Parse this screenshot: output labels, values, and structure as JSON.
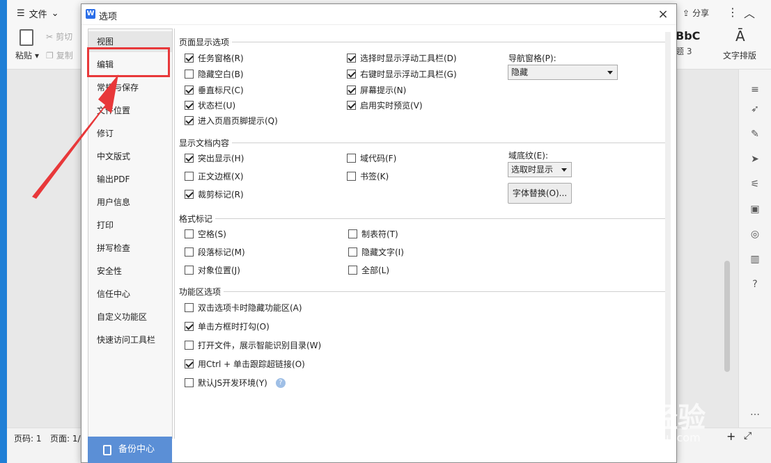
{
  "app": {
    "file_menu": "文件",
    "share": "分享",
    "paste": "粘贴",
    "cut": "剪切",
    "copy": "复制",
    "style_preview": "BbC",
    "style_name": "题 3",
    "text_layout": "文字排版",
    "status_page": "页码: 1",
    "status_pages": "页面: 1/",
    "zoom_in": "+"
  },
  "dialog": {
    "title": "选项",
    "close": "×",
    "nav": [
      "视图",
      "编辑",
      "常规与保存",
      "文件位置",
      "修订",
      "中文版式",
      "输出PDF",
      "用户信息",
      "打印",
      "拼写检查",
      "安全性",
      "信任中心",
      "自定义功能区",
      "快速访问工具栏"
    ],
    "backup": "备份中心",
    "sections": {
      "page_display": "页面显示选项",
      "doc_content": "显示文档内容",
      "format_marks": "格式标记",
      "ribbon_options": "功能区选项"
    },
    "page_display_left": [
      {
        "label": "任务窗格(R)",
        "checked": true
      },
      {
        "label": "隐藏空白(B)",
        "checked": false
      },
      {
        "label": "垂直标尺(C)",
        "checked": true
      },
      {
        "label": "状态栏(U)",
        "checked": true
      },
      {
        "label": "进入页眉页脚提示(Q)",
        "checked": true
      }
    ],
    "page_display_right": [
      {
        "label": "选择时显示浮动工具栏(D)",
        "checked": true
      },
      {
        "label": "右键时显示浮动工具栏(G)",
        "checked": true
      },
      {
        "label": "屏幕提示(N)",
        "checked": true
      },
      {
        "label": "启用实时预览(V)",
        "checked": true
      }
    ],
    "nav_pane_label": "导航窗格(P):",
    "nav_pane_value": "隐藏",
    "doc_content_left": [
      {
        "label": "突出显示(H)",
        "checked": true
      },
      {
        "label": "正文边框(X)",
        "checked": false
      },
      {
        "label": "裁剪标记(R)",
        "checked": true
      }
    ],
    "doc_content_right": [
      {
        "label": "域代码(F)",
        "checked": false
      },
      {
        "label": "书签(K)",
        "checked": false
      }
    ],
    "shading_label": "域底纹(E):",
    "shading_value": "选取时显示",
    "font_sub": "字体替换(O)...",
    "format_left": [
      {
        "label": "空格(S)",
        "checked": false
      },
      {
        "label": "段落标记(M)",
        "checked": false
      },
      {
        "label": "对象位置(J)",
        "checked": false
      }
    ],
    "format_right": [
      {
        "label": "制表符(T)",
        "checked": false
      },
      {
        "label": "隐藏文字(I)",
        "checked": false
      },
      {
        "label": "全部(L)",
        "checked": false
      }
    ],
    "ribbon": [
      {
        "label": "双击选项卡时隐藏功能区(A)",
        "checked": false
      },
      {
        "label": "单击方框时打勾(O)",
        "checked": true
      },
      {
        "label": "打开文件，展示智能识别目录(W)",
        "checked": false
      },
      {
        "label": "用Ctrl + 单击跟踪超链接(O)",
        "checked": true
      },
      {
        "label": "默认JS开发环境(Y)",
        "checked": false
      }
    ],
    "help": "?"
  },
  "watermark": {
    "main": "Bai 经验",
    "sub": "jingyan.baidu.com"
  },
  "colors": {
    "highlight": "#e8383a",
    "backup_bg": "#5b8fd6",
    "desktop": "#1f7fd6"
  }
}
